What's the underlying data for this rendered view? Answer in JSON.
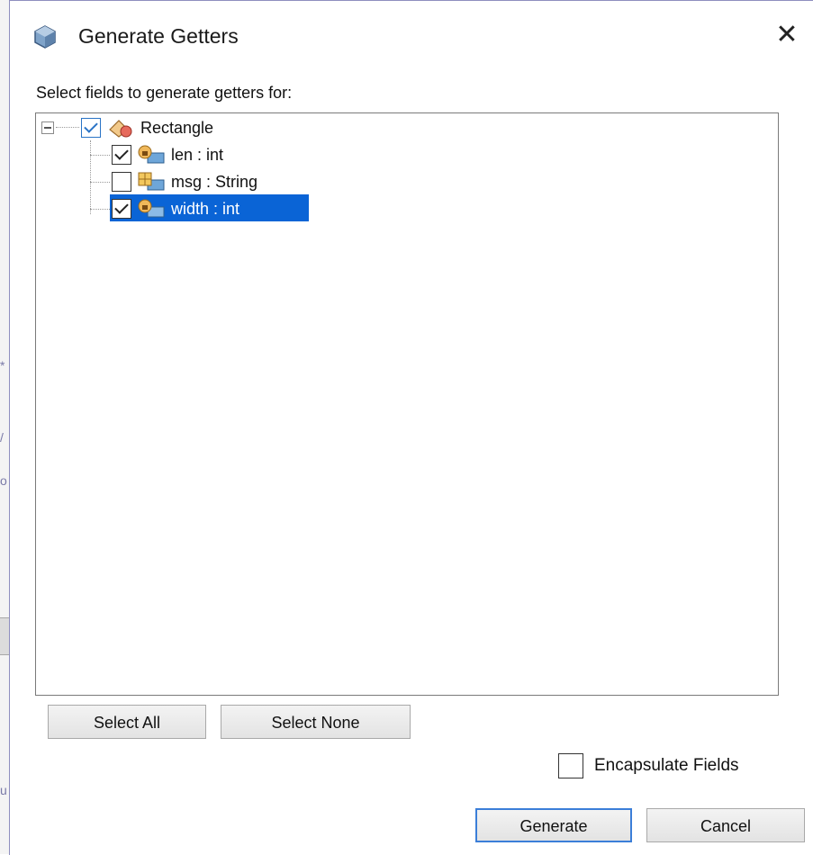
{
  "dialog": {
    "title": "Generate Getters",
    "close_symbol": "✕",
    "prompt": "Select fields to generate getters for:"
  },
  "tree": {
    "root": {
      "label": "Rectangle",
      "checked": true,
      "icon": "class-icon"
    },
    "fields": [
      {
        "label": "len : int",
        "checked": true,
        "icon": "private-field-icon",
        "selected": false
      },
      {
        "label": "msg : String",
        "checked": false,
        "icon": "field-icon",
        "selected": false
      },
      {
        "label": "width : int",
        "checked": true,
        "icon": "private-field-icon",
        "selected": true
      }
    ]
  },
  "buttons": {
    "select_all": "Select All",
    "select_none": "Select None",
    "generate": "Generate",
    "cancel": "Cancel"
  },
  "options": {
    "encapsulate_label": "Encapsulate Fields",
    "encapsulate_checked": false
  },
  "colors": {
    "selection": "#0a64d6",
    "accent": "#3b7ed8"
  }
}
